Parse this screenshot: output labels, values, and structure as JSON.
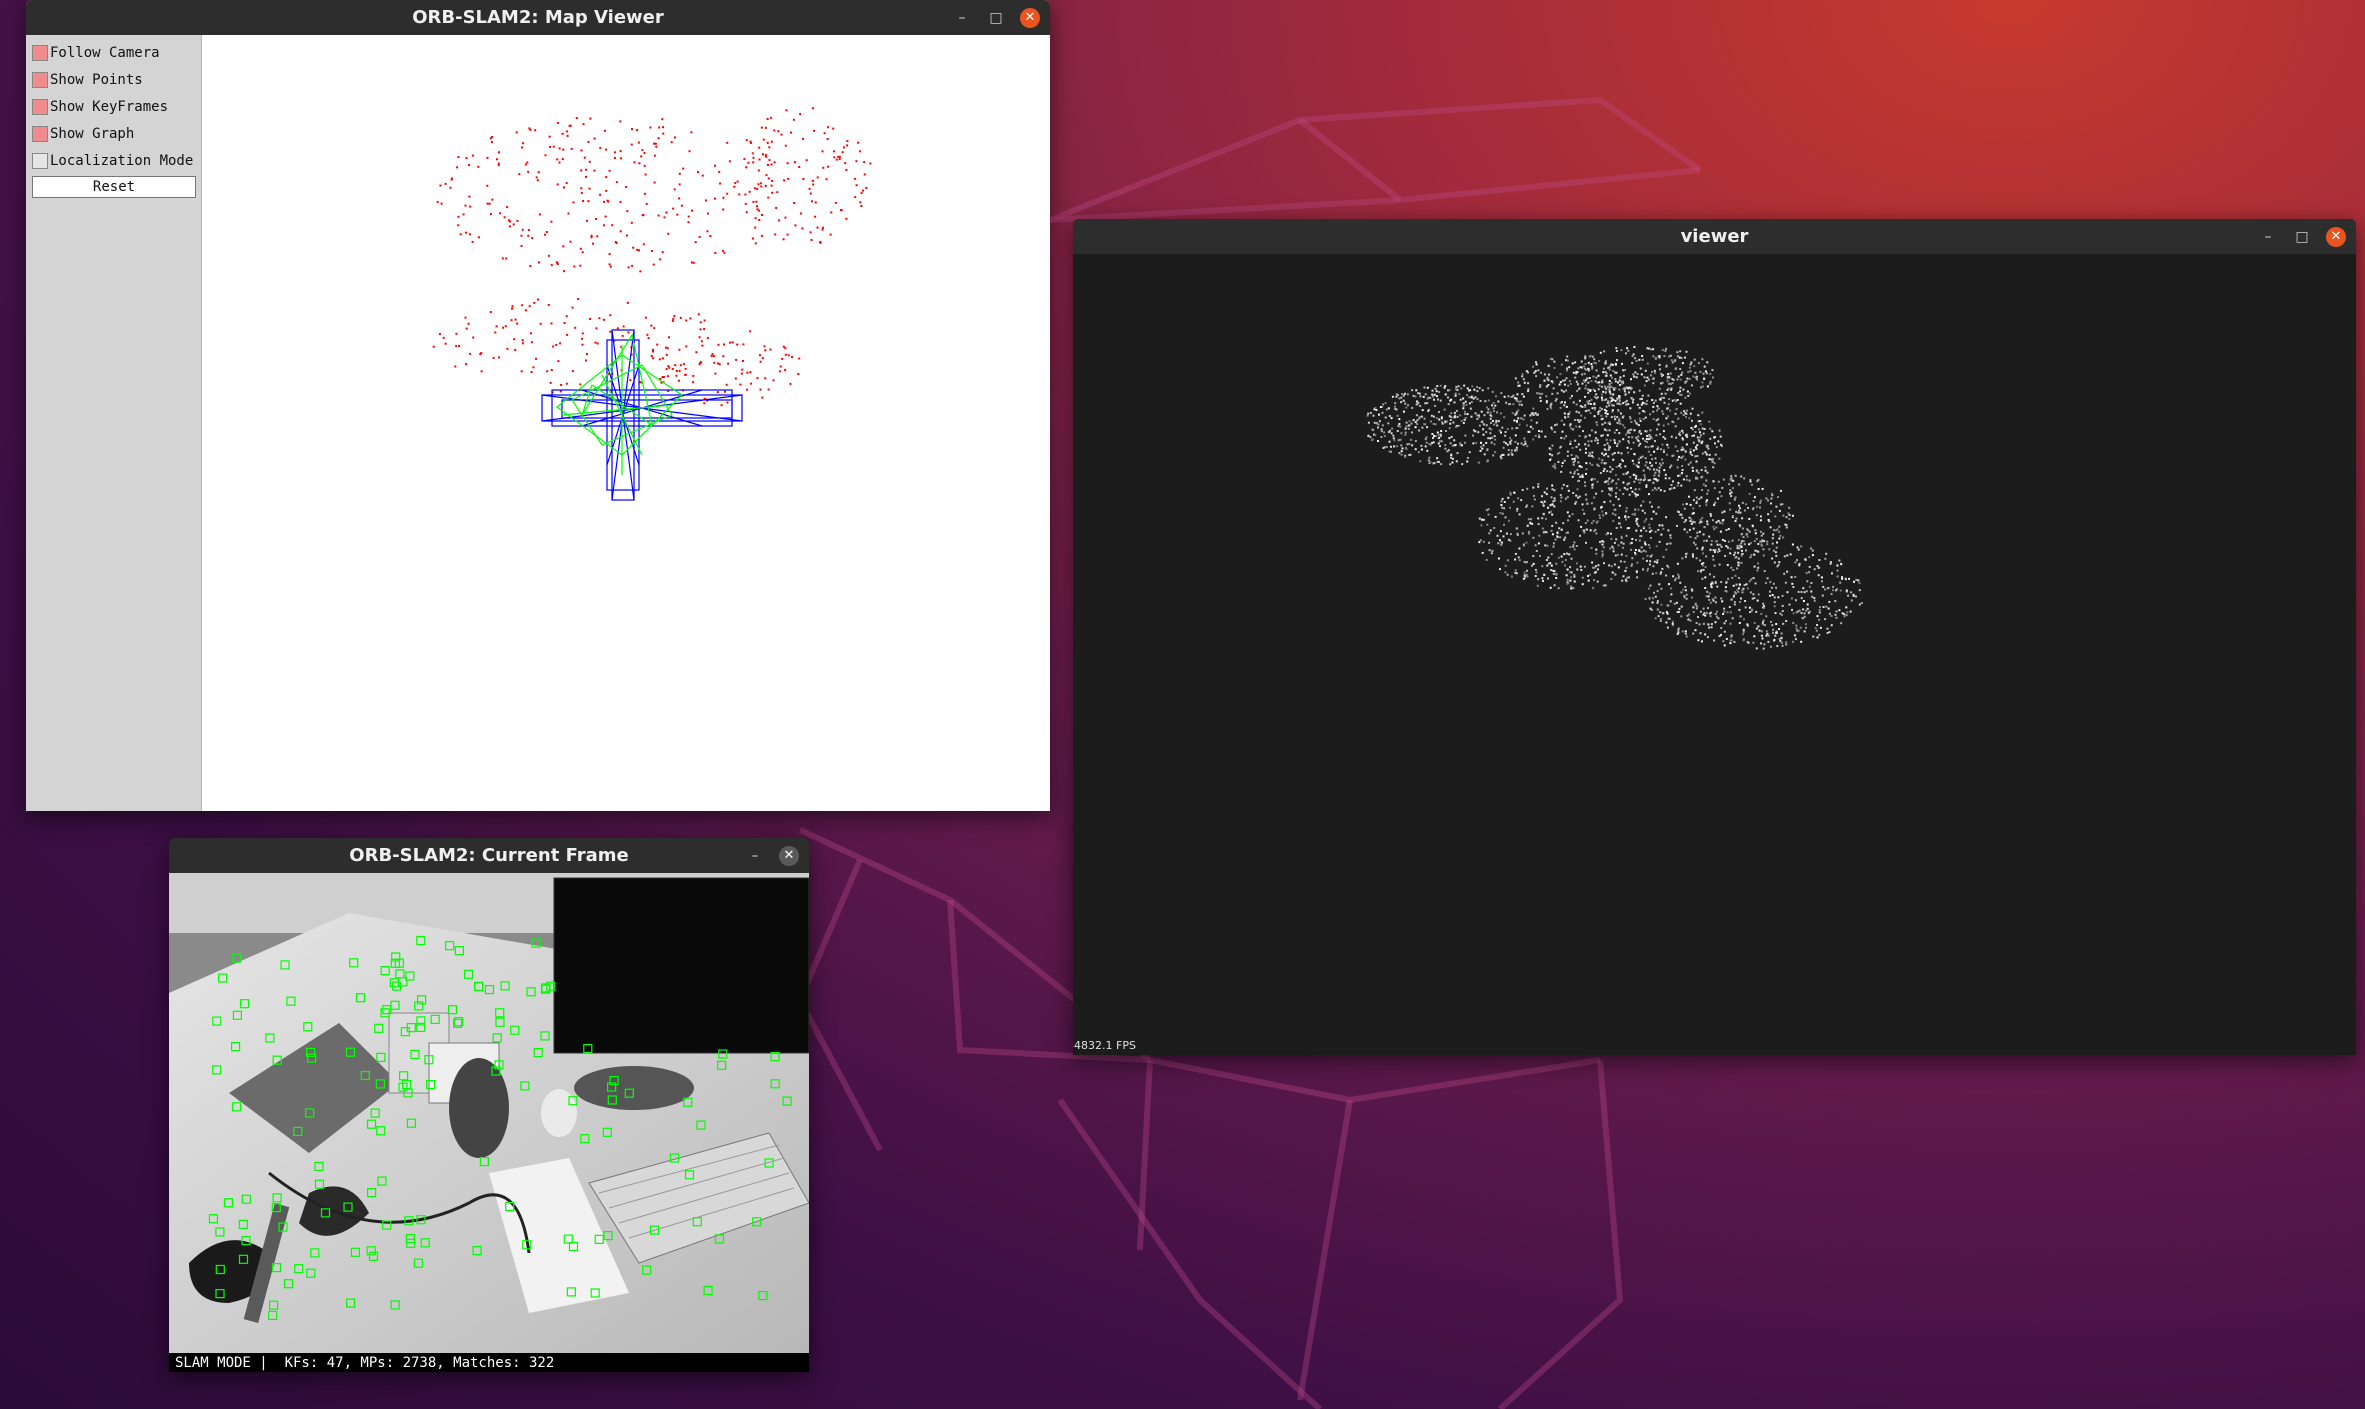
{
  "colors": {
    "titlebar": "#2d2d2d",
    "close_active": "#e95420",
    "checkbox_on": "#f08c8c",
    "map_point": "#ff0000",
    "keyframe": "#0000ff",
    "graph": "#00ff00",
    "feature": "#00ff00",
    "viewer_bg": "#1c1c1c"
  },
  "map_viewer": {
    "title": "ORB-SLAM2: Map Viewer",
    "menu": [
      {
        "label": "Follow Camera",
        "checked": true
      },
      {
        "label": "Show Points",
        "checked": true
      },
      {
        "label": "Show KeyFrames",
        "checked": true
      },
      {
        "label": "Show Graph",
        "checked": true
      },
      {
        "label": "Localization Mode",
        "checked": false
      }
    ],
    "reset_label": "Reset"
  },
  "current_frame": {
    "title": "ORB-SLAM2: Current Frame",
    "status": "SLAM MODE |  KFs: 47, MPs: 2738, Matches: 322"
  },
  "viewer": {
    "title": "viewer",
    "fps": "4832.1 FPS"
  },
  "window_controls": {
    "minimize_icon": "minimize-icon",
    "maximize_icon": "maximize-icon",
    "close_icon": "close-icon"
  }
}
